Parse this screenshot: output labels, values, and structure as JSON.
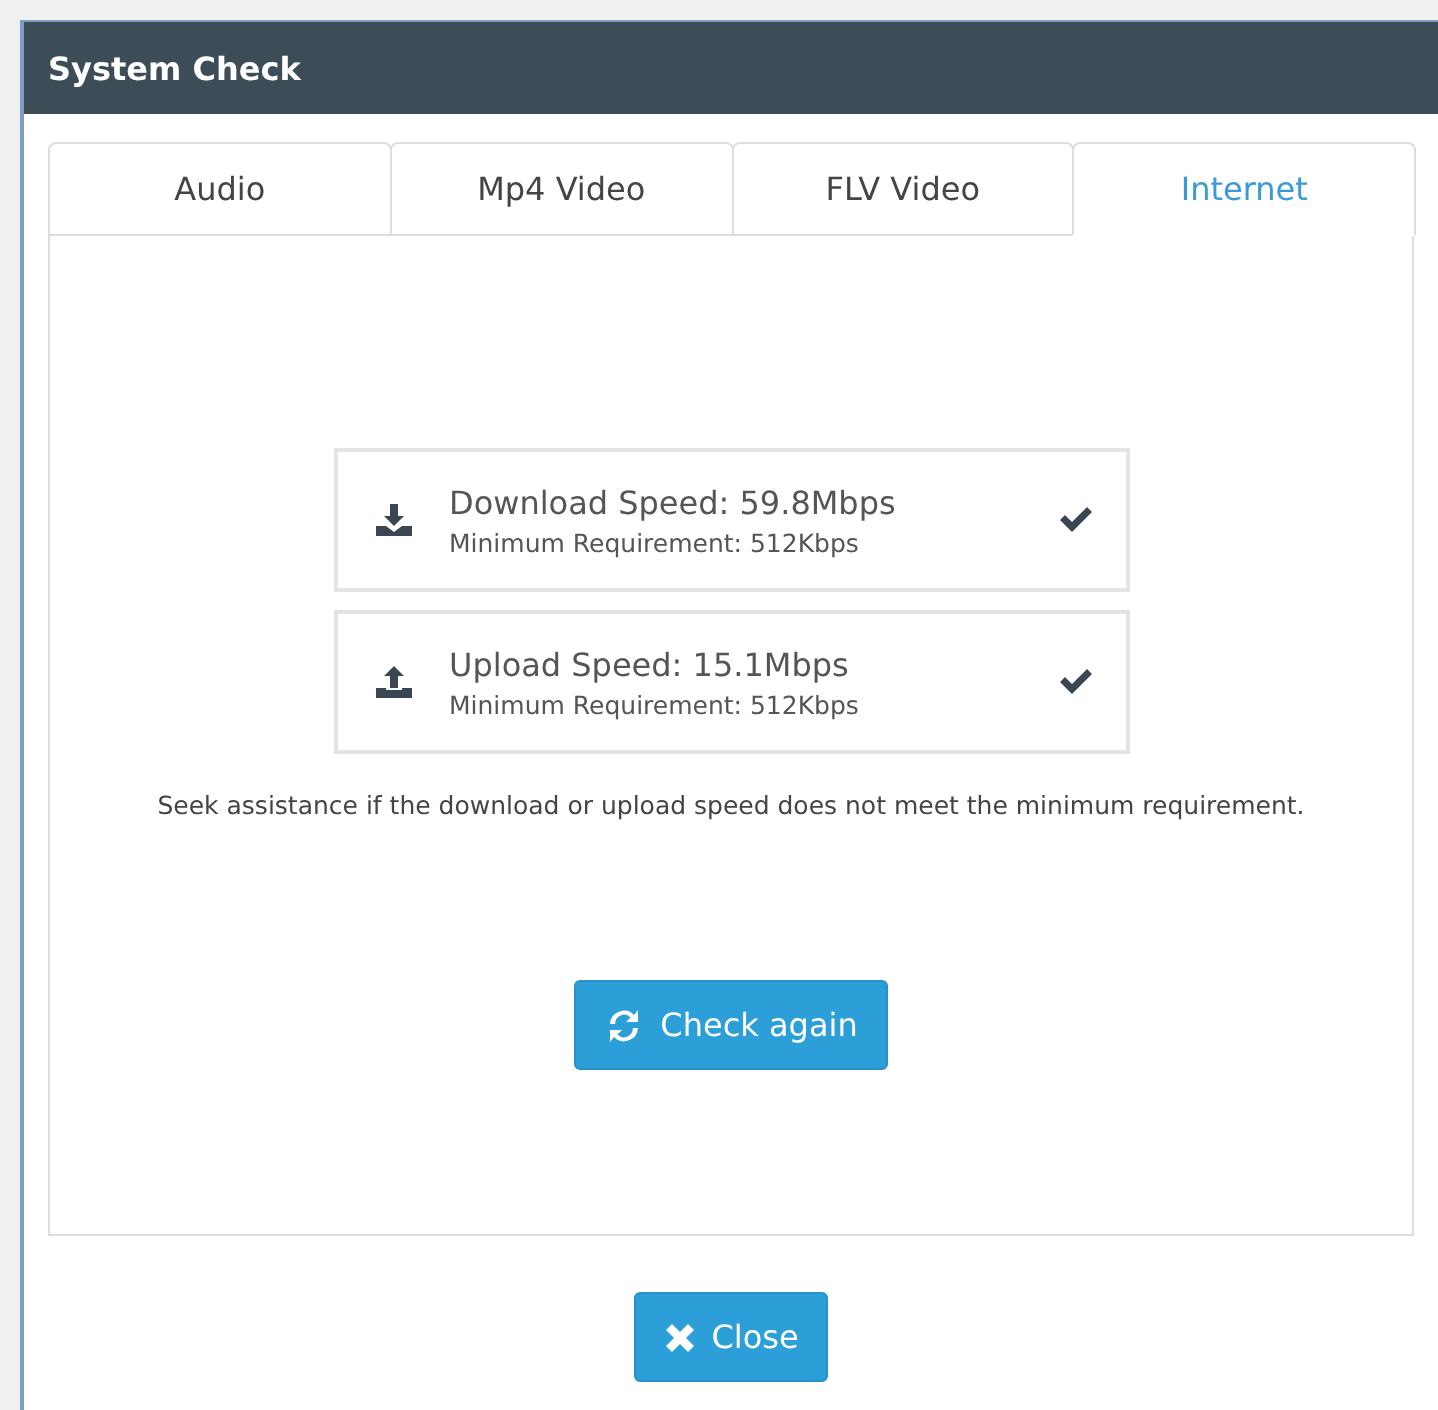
{
  "window": {
    "title": "System Check"
  },
  "tabs": [
    {
      "label": "Audio",
      "selected": false
    },
    {
      "label": "Mp4 Video",
      "selected": false
    },
    {
      "label": "FLV Video",
      "selected": false
    },
    {
      "label": "Internet",
      "selected": true
    }
  ],
  "speeds": [
    {
      "kind": "download",
      "title": "Download Speed: 59.8Mbps",
      "requirement": "Minimum Requirement: 512Kbps",
      "passed": true
    },
    {
      "kind": "upload",
      "title": "Upload Speed: 15.1Mbps",
      "requirement": "Minimum Requirement: 512Kbps",
      "passed": true
    }
  ],
  "note": "Seek assistance if the download or upload speed does not meet the minimum requirement.",
  "check_button": "Check again",
  "close_button": "Close"
}
